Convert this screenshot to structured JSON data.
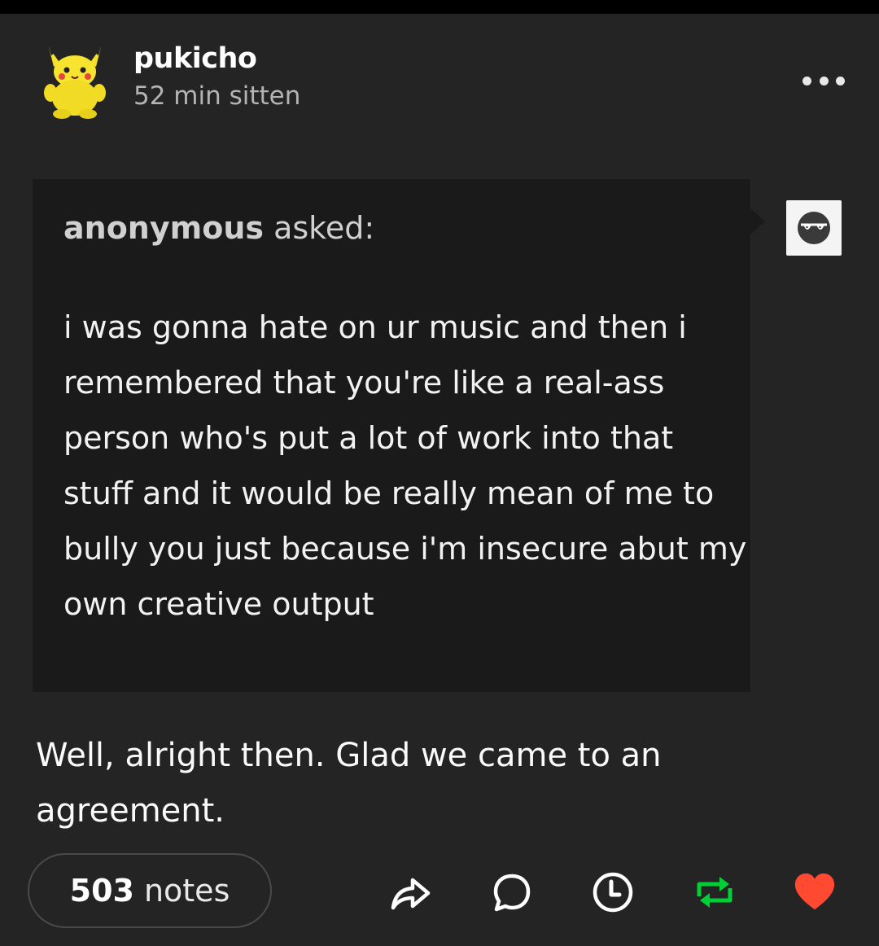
{
  "post": {
    "username": "pukicho",
    "timestamp": "52 min sitten"
  },
  "ask": {
    "asker": "anonymous",
    "asked_label": "asked:",
    "question": "i was gonna hate on ur music and then i remembered that you're like a real-ass person who's put a lot of work into that stuff and it would be really mean of me to bully you just because i'm insecure abut my own creative output"
  },
  "answer": "Well, alright then. Glad we came to an agreement.",
  "footer": {
    "notes_count": "503",
    "notes_label": "notes"
  },
  "icons": {
    "avatar": "pikachu-plush-avatar",
    "more": "more-dots-icon",
    "anon_avatar": "sunglasses-face-icon",
    "share": "share-arrow-icon",
    "reply": "speech-bubble-icon",
    "schedule": "clock-icon",
    "reblog": "reblog-icon",
    "like": "heart-icon"
  },
  "colors": {
    "background": "#242424",
    "ask_background": "#1a1a1a",
    "reblog": "#00cf35",
    "like": "#ff4930"
  }
}
